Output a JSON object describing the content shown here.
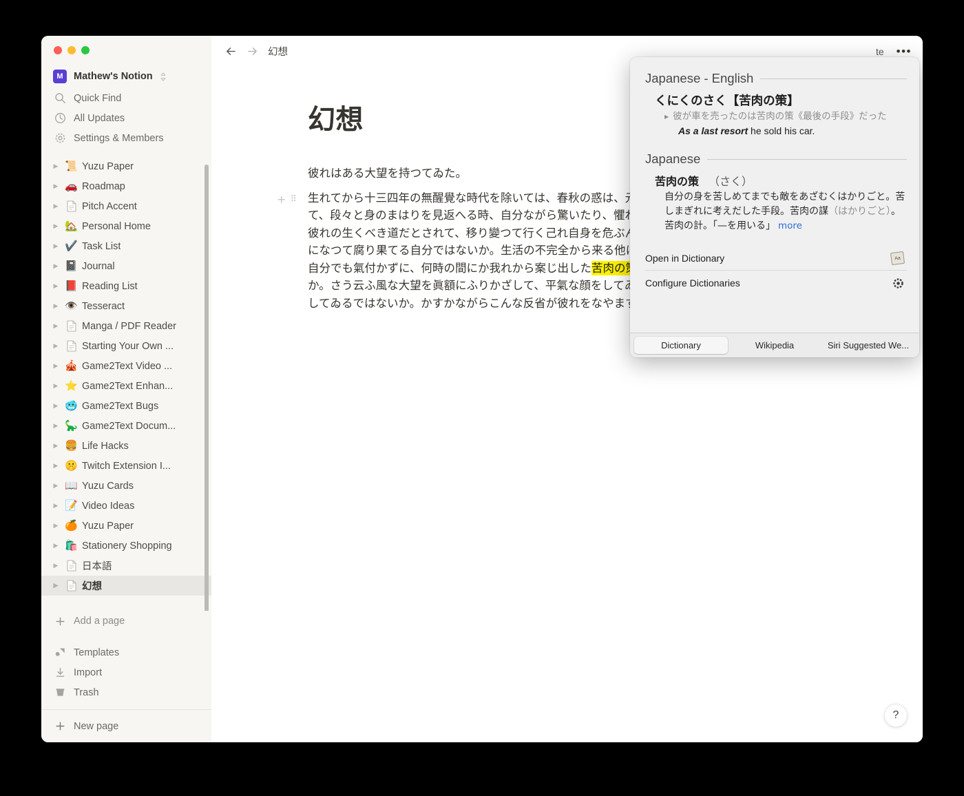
{
  "window": {
    "traffic_lights": [
      "close",
      "minimize",
      "zoom"
    ]
  },
  "sidebar": {
    "workspace": {
      "avatar_letter": "M",
      "name": "Mathew's Notion"
    },
    "nav_top": [
      {
        "icon": "search-icon",
        "label": "Quick Find"
      },
      {
        "icon": "clock-icon",
        "label": "All Updates"
      },
      {
        "icon": "gear-icon",
        "label": "Settings & Members"
      }
    ],
    "pages": [
      {
        "emoji": "📜",
        "label": "Yuzu Paper",
        "selected": false
      },
      {
        "emoji": "🚗",
        "label": "Roadmap",
        "selected": false
      },
      {
        "emoji": "doc",
        "label": "Pitch Accent",
        "selected": false
      },
      {
        "emoji": "🏡",
        "label": "Personal Home",
        "selected": false
      },
      {
        "emoji": "✔️",
        "label": "Task List",
        "selected": false
      },
      {
        "emoji": "📓",
        "label": "Journal",
        "selected": false
      },
      {
        "emoji": "📕",
        "label": "Reading List",
        "selected": false
      },
      {
        "emoji": "👁️",
        "label": "Tesseract",
        "selected": false
      },
      {
        "emoji": "doc",
        "label": "Manga / PDF Reader",
        "selected": false
      },
      {
        "emoji": "doc",
        "label": "Starting Your Own ...",
        "selected": false
      },
      {
        "emoji": "🎪",
        "label": "Game2Text Video ...",
        "selected": false
      },
      {
        "emoji": "⭐",
        "label": "Game2Text Enhan...",
        "selected": false
      },
      {
        "emoji": "🥶",
        "label": "Game2Text Bugs",
        "selected": false
      },
      {
        "emoji": "🦕",
        "label": "Game2Text Docum...",
        "selected": false
      },
      {
        "emoji": "🍔",
        "label": "Life Hacks",
        "selected": false
      },
      {
        "emoji": "🤫",
        "label": "Twitch Extension I...",
        "selected": false
      },
      {
        "emoji": "📖",
        "label": "Yuzu Cards",
        "selected": false
      },
      {
        "emoji": "📝",
        "label": "Video Ideas",
        "selected": false
      },
      {
        "emoji": "🍊",
        "label": "Yuzu Paper",
        "selected": false
      },
      {
        "emoji": "🛍️",
        "label": "Stationery Shopping",
        "selected": false
      },
      {
        "emoji": "doc",
        "label": "日本語",
        "selected": false
      },
      {
        "emoji": "doc",
        "label": "幻想",
        "selected": true
      }
    ],
    "add_page_label": "Add a page",
    "nav_bottom": [
      {
        "icon": "templates-icon",
        "label": "Templates"
      },
      {
        "icon": "import-icon",
        "label": "Import"
      },
      {
        "icon": "trash-icon",
        "label": "Trash"
      }
    ],
    "new_page_label": "New page"
  },
  "topbar": {
    "back": "←",
    "forward": "→",
    "breadcrumb": "幻想",
    "update_label": "te",
    "more_label": "•••"
  },
  "document": {
    "title": "幻想",
    "paragraph_1": "彼れはある大望を持つてゐた。",
    "paragraph_2_before_highlight": "生れてから十三四年の無醒覺な時代を除いては、春秋の惑は、元來人なつこく出來た彼れを引きずつて、段々と身のまはりを見返へる時、自分ながら驚いたり、懼れた。今のこの生活——この生活一つが彼れの生くべき道だとされて、移り變つて行く己れ自身を危ぶんで見ないで、つまらない幻想の翻弄物になつて腐り果てる自分ではないか。生活の不完全から来る他に、まうして逃げる卑劣な手段として、自分でも氣付かずに、何時の間にか我れから案じ出した",
    "highlight": "苦肉の策",
    "paragraph_2_after_highlight": "が、所謂彼れの大望なるものではないか。さう云ふ風な大望を眞額にふりかざして、平氣な顔をしてゐる輩は、いくらでもそこらにごろ／＼してゐるではないか。かすかながらこんな反省が彼れをなやます事は稀れではなかつた。",
    "help_label": "?",
    "highlight_color": "#fff300"
  },
  "dictionary_popup": {
    "section_1_title": "Japanese - English",
    "entry_1": {
      "term": "くにくのさく【苦肉の策】",
      "example_jp": "彼が車を売ったのは苦肉の策《最後の手段》だった",
      "example_en_italic": "As a last resort",
      "example_en_rest": " he sold his car."
    },
    "section_2_title": "Japanese",
    "entry_2": {
      "term": "苦肉の策",
      "reading": "（さく）",
      "definition_part_1": "自分の身を苦しめてまでも敵をあざむくはかりごと。苦しまぎれに考えだした手段。苦肉の謀",
      "definition_dim": "（はかりごと）",
      "definition_part_2": "。苦肉の計。「—を用いる」",
      "more_label": "more"
    },
    "actions": [
      {
        "label": "Open in Dictionary",
        "icon": "dictionary-book-icon"
      },
      {
        "label": "Configure Dictionaries",
        "icon": "gear-icon"
      }
    ],
    "tabs": [
      {
        "label": "Dictionary",
        "active": true
      },
      {
        "label": "Wikipedia",
        "active": false
      },
      {
        "label": "Siri Suggested We...",
        "active": false
      }
    ]
  }
}
